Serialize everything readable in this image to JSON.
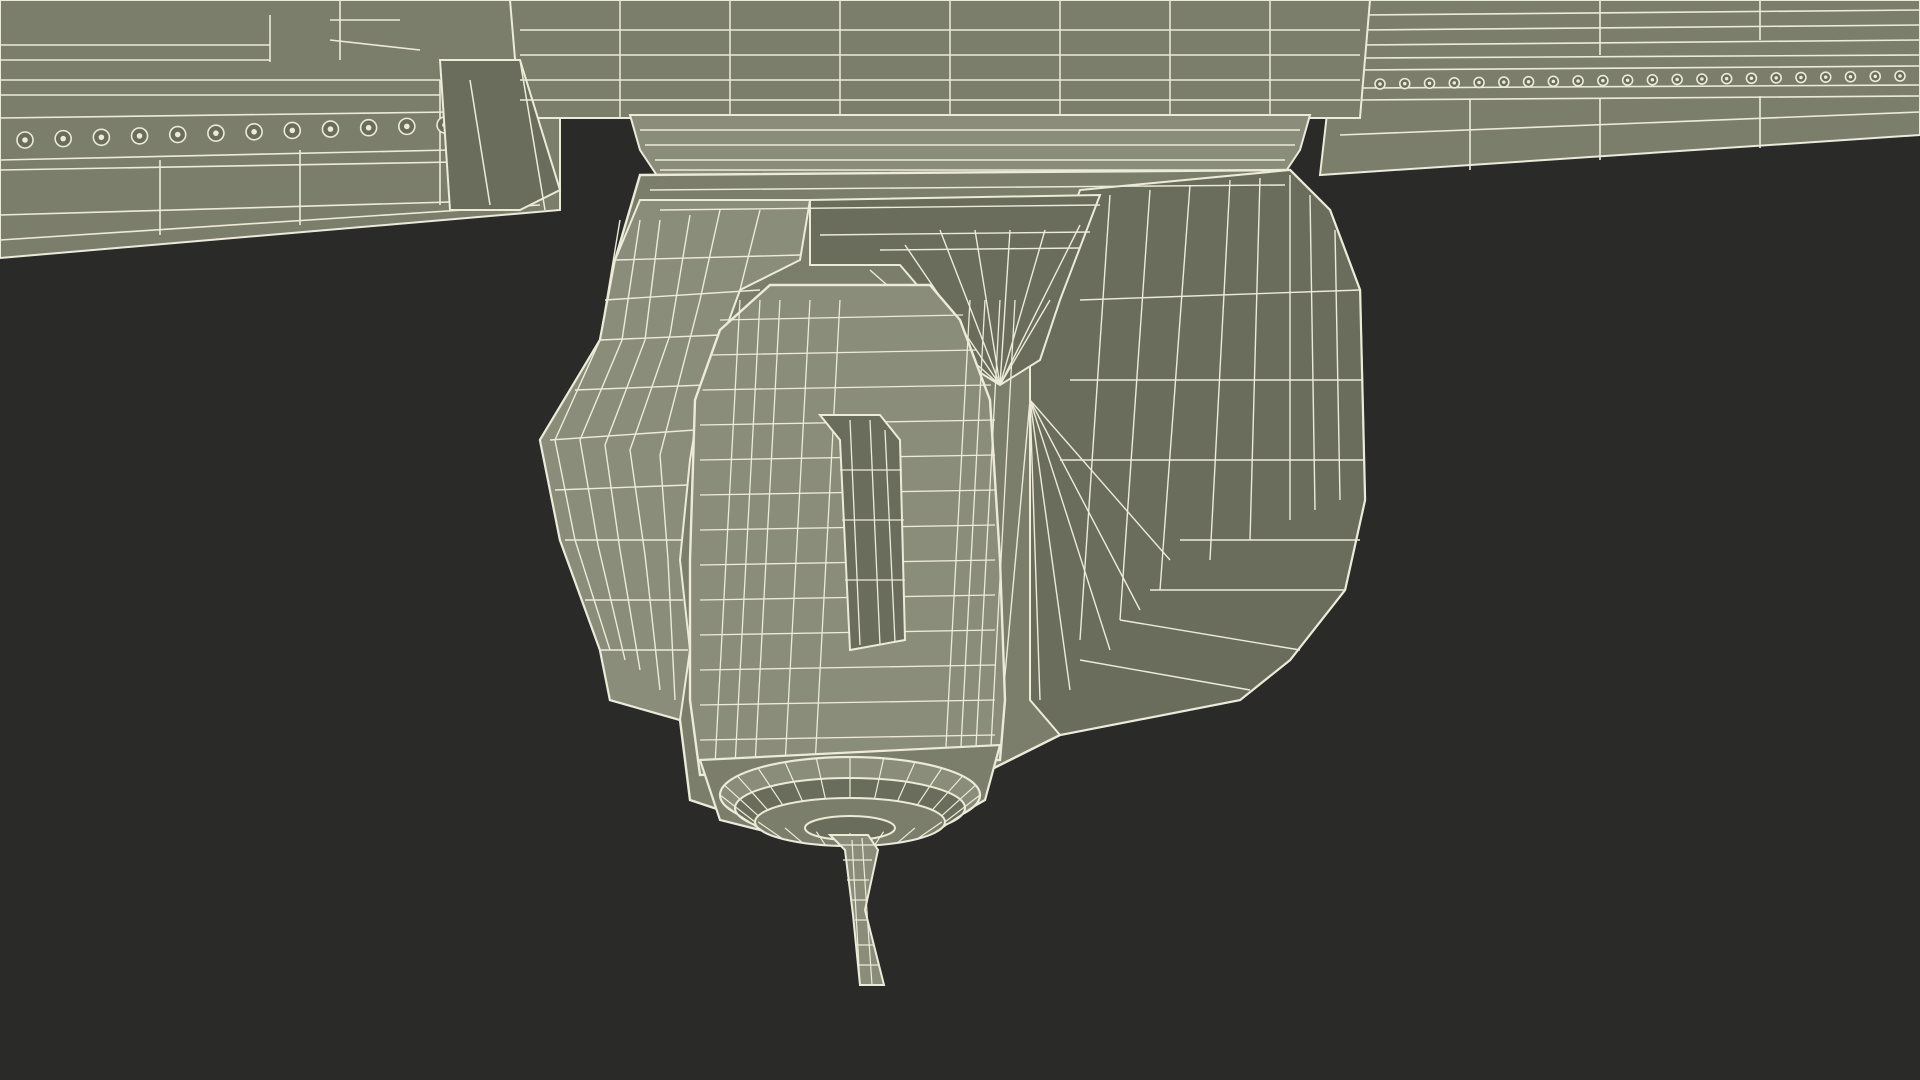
{
  "scene": {
    "subject": "cnc-spindle-head-wireframe",
    "colors": {
      "background": "#2a2b28",
      "surface": "#7b7e6b",
      "surface_light": "#8a8d79",
      "surface_dark": "#6a6d5c",
      "wire": "#ecebd9",
      "shadow": "#5e6152"
    }
  }
}
